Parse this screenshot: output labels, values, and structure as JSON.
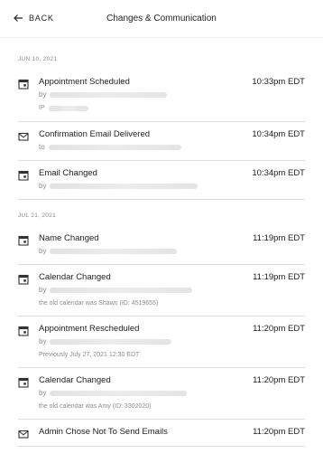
{
  "header": {
    "back_label": "BACK",
    "title": "Changes & Communication"
  },
  "sections": [
    {
      "date": "JUN 10, 2021",
      "entries": [
        {
          "icon": "calendar-icon",
          "name": "Appointment Scheduled",
          "time": "10:33pm EDT",
          "sub_prefix": "by",
          "extra_prefix": "IP"
        },
        {
          "icon": "mail-icon",
          "name": "Confirmation Email Delivered",
          "time": "10:34pm EDT",
          "sub_prefix": "to"
        },
        {
          "icon": "calendar-icon",
          "name": "Email Changed",
          "time": "10:34pm EDT",
          "sub_prefix": "by"
        }
      ]
    },
    {
      "date": "JUL 21, 2021",
      "entries": [
        {
          "icon": "calendar-icon",
          "name": "Name Changed",
          "time": "11:19pm EDT",
          "sub_prefix": "by"
        },
        {
          "icon": "calendar-icon",
          "name": "Calendar Changed",
          "time": "11:19pm EDT",
          "sub_prefix": "by",
          "note": "the old calendar was Shawn (ID: 4519655)"
        },
        {
          "icon": "calendar-icon",
          "name": "Appointment Rescheduled",
          "time": "11:20pm EDT",
          "sub_prefix": "by",
          "note": "Previously July 27, 2021 12:30 EDT"
        },
        {
          "icon": "calendar-icon",
          "name": "Calendar Changed",
          "time": "11:20pm EDT",
          "sub_prefix": "by",
          "note": "the old calendar was Amy (ID: 3302020)"
        },
        {
          "icon": "mail-icon",
          "name": "Admin Chose Not To Send Emails",
          "time": "11:20pm EDT"
        }
      ]
    }
  ]
}
